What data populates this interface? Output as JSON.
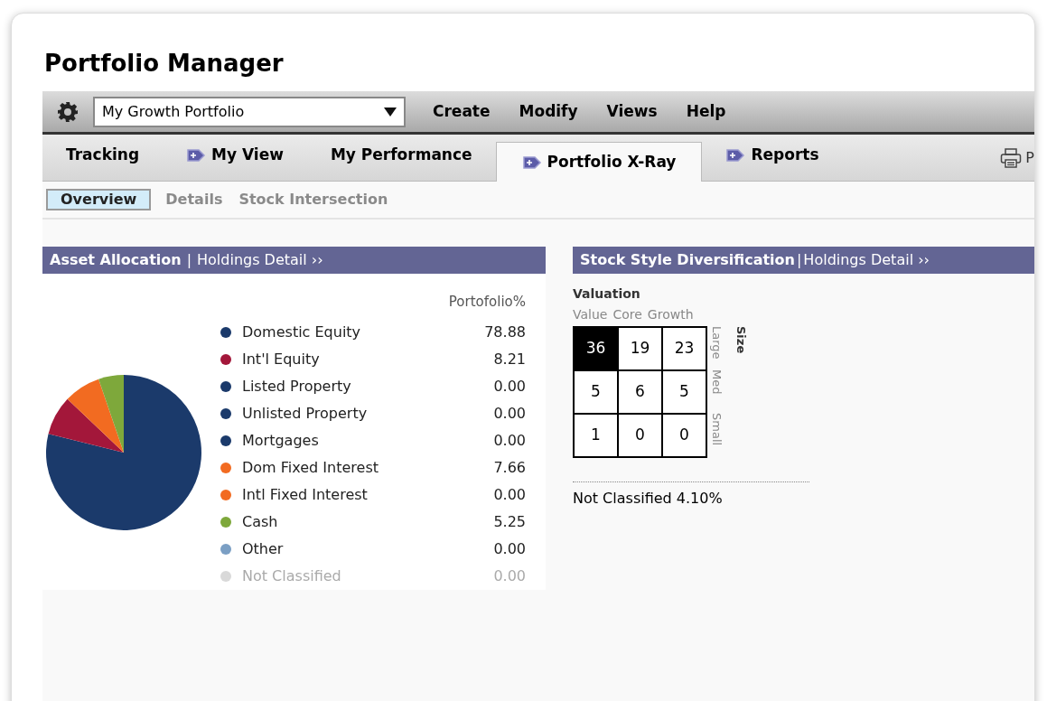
{
  "title": "Portfolio Manager",
  "toolbar": {
    "portfolio_select": {
      "value": "My Growth Portfolio"
    },
    "menu": [
      "Create",
      "Modify",
      "Views",
      "Help"
    ]
  },
  "tabs": [
    {
      "label": "Tracking",
      "icon": false,
      "selected": false
    },
    {
      "label": "My View",
      "icon": true,
      "selected": false
    },
    {
      "label": "My Performance",
      "icon": false,
      "selected": false
    },
    {
      "label": "Portfolio X-Ray",
      "icon": true,
      "selected": true
    },
    {
      "label": "Reports",
      "icon": true,
      "selected": false
    }
  ],
  "print_link": "P",
  "subtabs": [
    {
      "label": "Overview",
      "selected": true
    },
    {
      "label": "Details",
      "selected": false
    },
    {
      "label": "Stock Intersection",
      "selected": false
    }
  ],
  "asset_allocation": {
    "title": "Asset Allocation",
    "separator": "|",
    "link": "Holdings Detail",
    "link_mark": "››",
    "rows": [
      {
        "value": "78.88",
        "color": "#1b3a6b",
        "muted": false
      },
      {
        "value": "8.21",
        "color": "#a3173a",
        "muted": false
      },
      {
        "value": "0.00",
        "color": "#1b3a6b",
        "muted": false
      },
      {
        "value": "0.00",
        "color": "#1b3a6b",
        "muted": false
      },
      {
        "value": "0.00",
        "color": "#1b3a6b",
        "muted": false
      },
      {
        "value": "7.66",
        "color": "#f26b21",
        "muted": false
      },
      {
        "value": "0.00",
        "color": "#f26b21",
        "muted": false
      },
      {
        "value": "5.25",
        "color": "#7ea83b",
        "muted": false
      },
      {
        "value": "0.00",
        "color": "#7b9fc4",
        "muted": false
      },
      {
        "value": "0.00",
        "color": "#d9d9d9",
        "muted": true
      }
    ],
    "chart_data": {
      "type": "pie",
      "categories": [
        "Domestic Equity",
        "Int'l Equity",
        "Listed Property",
        "Unlisted Property",
        "Mortgages",
        "Dom Fixed Interest",
        "Intl Fixed Interest",
        "Cash",
        "Other",
        "Not Classified"
      ],
      "series": [
        {
          "name": "Portofolio%",
          "values": [
            78.88,
            8.21,
            0,
            0,
            0,
            7.66,
            0,
            5.25,
            0,
            0
          ]
        }
      ]
    }
  },
  "style_box": {
    "title": "Stock Style Diversification",
    "separator": "|",
    "link": "Holdings Detail",
    "link_mark": "››",
    "axis_title": "Valuation",
    "columns": [
      "Value",
      "Core",
      "Growth"
    ],
    "size_title": "Size",
    "rows": [
      "Large",
      "Med",
      "Small"
    ],
    "cells": [
      [
        {
          "value": "36",
          "highlighted": true
        },
        {
          "value": "19",
          "highlighted": false
        },
        {
          "value": "23",
          "highlighted": false
        }
      ],
      [
        {
          "value": "5",
          "highlighted": false
        },
        {
          "value": "6",
          "highlighted": false
        },
        {
          "value": "5",
          "highlighted": false
        }
      ],
      [
        {
          "value": "1",
          "highlighted": false
        },
        {
          "value": "0",
          "highlighted": false
        },
        {
          "value": "0",
          "highlighted": false
        }
      ]
    ],
    "not_classified": "Not Classified 4.10%"
  }
}
